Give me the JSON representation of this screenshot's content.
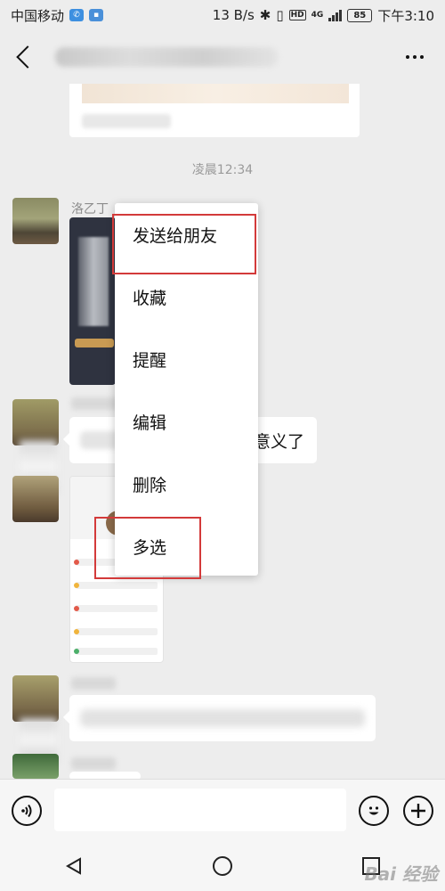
{
  "status_bar": {
    "carrier": "中国移动",
    "net_speed": "13 B/s",
    "network_type": "4G",
    "hd_label": "HD",
    "battery": "85",
    "time": "下午3:10"
  },
  "chat": {
    "timestamp": "凌晨12:34",
    "sender_name": "洛乙丁",
    "visible_message_fragment": "意义了"
  },
  "context_menu": {
    "items": [
      {
        "label": "发送给朋友",
        "highlighted": true
      },
      {
        "label": "收藏",
        "highlighted": false
      },
      {
        "label": "提醒",
        "highlighted": false
      },
      {
        "label": "编辑",
        "highlighted": false
      },
      {
        "label": "删除",
        "highlighted": false
      },
      {
        "label": "多选",
        "highlighted": true
      }
    ],
    "highlight_color": "#d33a3a"
  },
  "input_bar": {
    "placeholder": "",
    "voice_icon": "voice-icon",
    "emoji_icon": "emoji-icon",
    "plus_icon": "plus-icon"
  },
  "nav_bar": {
    "icons": [
      "back-triangle-icon",
      "home-circle-icon",
      "recents-square-icon"
    ]
  },
  "watermark": "Bai 经验"
}
